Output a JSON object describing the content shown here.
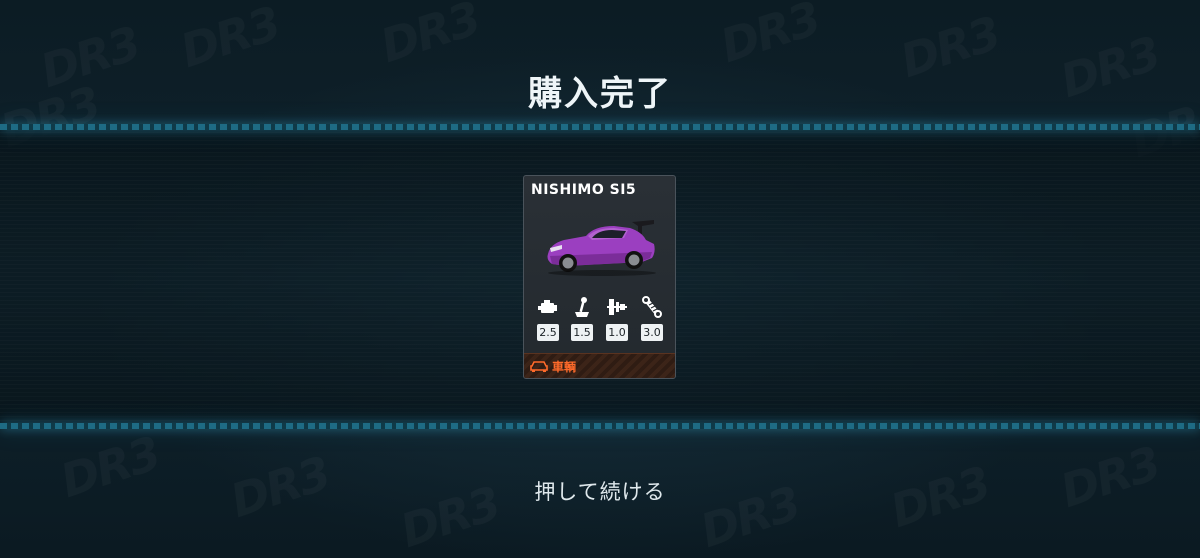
{
  "screen": {
    "title": "購入完了",
    "continue_prompt": "押して続ける",
    "watermark_text": "DR3"
  },
  "card": {
    "name": "NISHIMO SI5",
    "car_color": "#9b3fc0",
    "stats": [
      {
        "icon": "engine-icon",
        "value": "2.5"
      },
      {
        "icon": "gear-shifter-icon",
        "value": "1.5"
      },
      {
        "icon": "brake-icon",
        "value": "1.0"
      },
      {
        "icon": "suspension-icon",
        "value": "3.0"
      }
    ],
    "category_icon": "car-icon",
    "category_label": "車輌",
    "category_color": "#ff6a2a"
  },
  "colors": {
    "stripe_accent": "#1e6b84",
    "background": "#0b1a22"
  }
}
